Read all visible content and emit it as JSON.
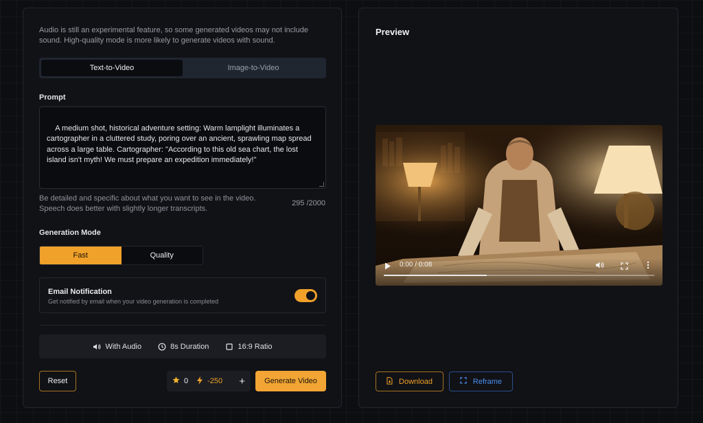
{
  "notice": "Audio is still an experimental feature, so some generated videos may not include sound. High-quality mode is more likely to generate videos with sound.",
  "tabs": [
    {
      "label": "Text-to-Video",
      "active": true
    },
    {
      "label": "Image-to-Video",
      "active": false
    }
  ],
  "prompt": {
    "label": "Prompt",
    "value": "A medium shot, historical adventure setting: Warm lamplight illuminates a cartographer in a cluttered study, poring over an ancient, sprawling map spread across a large table. Cartographer: \"According to this old sea chart, the lost island isn't myth! We must prepare an expedition immediately!\"",
    "helper": "Be detailed and specific about what you want to see in the video. Speech does better with slightly longer transcripts.",
    "counter": "295 /2000"
  },
  "generation_mode": {
    "label": "Generation Mode",
    "options": [
      {
        "label": "Fast",
        "active": true
      },
      {
        "label": "Quality",
        "active": false
      }
    ]
  },
  "email": {
    "title": "Email Notification",
    "subtitle": "Get notified by email when your video generation is completed",
    "enabled": true
  },
  "features": {
    "audio": "With Audio",
    "duration": "8s Duration",
    "ratio": "16:9 Ratio"
  },
  "actions": {
    "reset": "Reset",
    "credits": "0",
    "cost": "-250",
    "plus": "+",
    "generate": "Generate Video"
  },
  "preview": {
    "title": "Preview",
    "time": "0:00 / 0:08",
    "progress_fraction": 0.38,
    "download": "Download",
    "reframe": "Reframe"
  },
  "colors": {
    "accent": "#f0a12a",
    "link_blue": "#4c8ef0"
  }
}
